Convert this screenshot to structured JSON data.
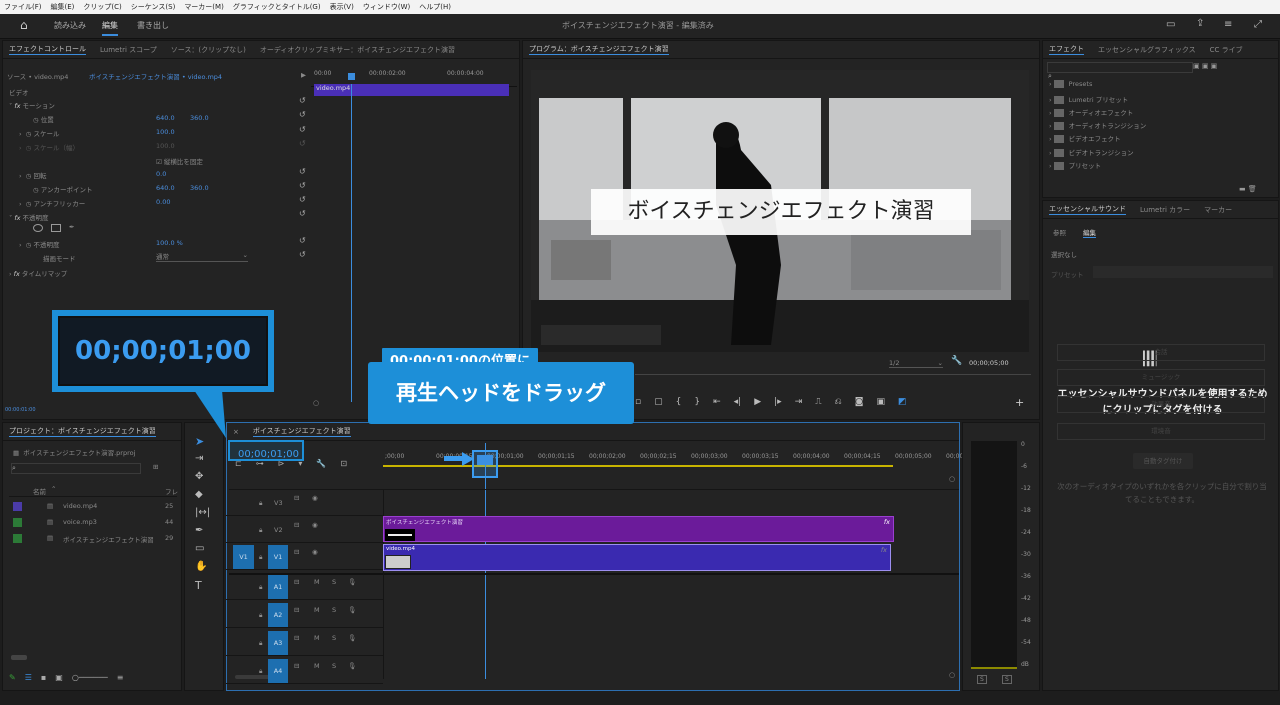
{
  "menu": [
    "ファイル(F)",
    "編集(E)",
    "クリップ(C)",
    "シーケンス(S)",
    "マーカー(M)",
    "グラフィックとタイトル(G)",
    "表示(V)",
    "ウィンドウ(W)",
    "ヘルプ(H)"
  ],
  "workspace": {
    "tabs": [
      "読み込み",
      "編集",
      "書き出し"
    ],
    "title": "ボイスチェンジエフェクト演習 - 編集済み"
  },
  "effect_controls": {
    "tabs": [
      "エフェクトコントロール",
      "Lumetri スコープ",
      "ソース：(クリップなし)",
      "オーディオクリップミキサー：ボイスチェンジエフェクト演習"
    ],
    "source_header": "ソース • video.mp4",
    "seq_header": "ボイスチェンジエフェクト演習 • video.mp4",
    "section_video": "ビデオ",
    "motion": "モーション",
    "position_label": "位置",
    "position_x": "640.0",
    "position_y": "360.0",
    "scale_label": "スケール",
    "scale_value": "100.0",
    "scale_w_label": "スケール（幅）",
    "scale_w_value": "100.0",
    "uniform_label": "縦横比を固定",
    "rotation_label": "回転",
    "rotation_value": "0.0",
    "anchor_label": "アンカーポイント",
    "anchor_x": "640.0",
    "anchor_y": "360.0",
    "flicker_label": "アンチフリッカー",
    "flicker_value": "0.00",
    "opacity_group": "不透明度",
    "opacity_label": "不透明度",
    "opacity_value": "100.0 %",
    "blend_label": "描画モード",
    "blend_value": "通常",
    "timeremap": "タイムリマップ",
    "ruler": [
      "00:00",
      "00:00:02:00",
      "00:00:04:00"
    ],
    "clip": "video.mp4",
    "current_time": "00:00:01:00"
  },
  "program": {
    "tab": "プログラム：ボイスチェンジエフェクト演習",
    "title_overlay": "ボイスチェンジエフェクト演習",
    "quality": "1/2",
    "duration": "00;00;05;00"
  },
  "effects_panel": {
    "tabs": [
      "エフェクト",
      "エッセンシャルグラフィックス",
      "CC ライブ"
    ],
    "items": [
      "Presets",
      "Lumetri プリセット",
      "オーディオエフェクト",
      "オーディオトランジション",
      "ビデオエフェクト",
      "ビデオトランジション",
      "プリセット"
    ]
  },
  "essential_sound": {
    "tabs": [
      "エッセンシャルサウンド",
      "Lumetri カラー",
      "マーカー"
    ],
    "subtabs": [
      "参照",
      "編集"
    ],
    "none_selected": "選択なし",
    "preset": "プリセット",
    "message": "エッセンシャルサウンドパネルを使用するためにクリップにタグを付ける",
    "auto_tag": "自動タグ付け",
    "hint": "次のオーディオタイプのいずれかを各クリップに自分で割り当てることもできます。",
    "types": [
      "会話",
      "ミュージック",
      "効果音",
      "環境音"
    ]
  },
  "project": {
    "tab": "プロジェクト：ボイスチェンジエフェクト演習",
    "file": "ボイスチェンジエフェクト演習.prproj",
    "col_name": "名前",
    "col_fps": "フレ",
    "items": [
      {
        "name": "video.mp4",
        "fps": "25",
        "color": "#4b3ba8"
      },
      {
        "name": "voice.mp3",
        "fps": "44",
        "color": "#2c7a37"
      },
      {
        "name": "ボイスチェンジエフェクト演習",
        "fps": "29",
        "color": "#2c7a37"
      }
    ]
  },
  "timeline": {
    "tab": "ボイスチェンジエフェクト演習",
    "timecode": "00;00;01;00",
    "ruler": [
      ";00;00",
      "00;00;00;15",
      "00;00;01;00",
      "00;00;01;15",
      "00;00;02;00",
      "00;00;02;15",
      "00;00;03;00",
      "00;00;03;15",
      "00;00;04;00",
      "00;00;04;15",
      "00;00;05;00",
      "00;00"
    ],
    "tracks_video": [
      "V3",
      "V2",
      "V1"
    ],
    "tracks_audio": [
      "A1",
      "A2",
      "A3",
      "A4"
    ],
    "clip_v2": "ボイスチェンジエフェクト演習",
    "clip_v1": "video.mp4",
    "source_patch": "V1"
  },
  "meter": [
    "0",
    "-6",
    "-12",
    "-18",
    "-24",
    "-30",
    "-36",
    "-42",
    "-48",
    "-54",
    "dB"
  ],
  "callouts": {
    "timecode": "00;00;01;00",
    "line1": "00:00:01:00の位置に",
    "line2": "再生ヘッドをドラッグ"
  },
  "status": "00;00;01;00"
}
